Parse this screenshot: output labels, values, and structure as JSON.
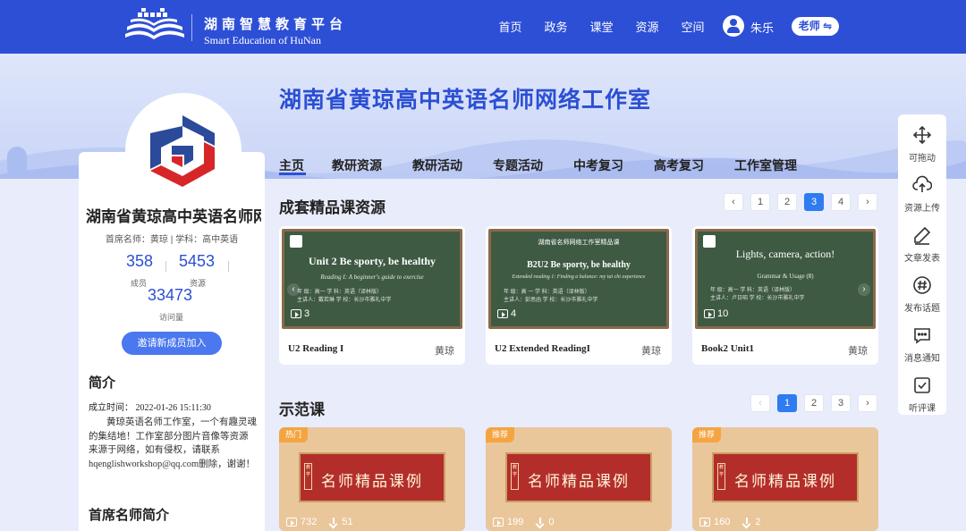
{
  "header": {
    "platform_cn": "湖南智慧教育平台",
    "platform_en": "Smart Education of HuNan",
    "nav": [
      "首页",
      "政务",
      "课堂",
      "资源",
      "空间"
    ],
    "user_name": "朱乐",
    "role": "老师 ⇋"
  },
  "banner": {
    "title": "湖南省黄琼高中英语名师网络工作室"
  },
  "tabs": [
    {
      "label": "主页",
      "active": true
    },
    {
      "label": "教研资源"
    },
    {
      "label": "教研活动"
    },
    {
      "label": "专题活动"
    },
    {
      "label": "中考复习"
    },
    {
      "label": "高考复习"
    },
    {
      "label": "工作室管理"
    }
  ],
  "profile": {
    "name": "湖南省黄琼高中英语名师网络工作室",
    "meta": "首席名师：黄琼  |  学科：高中英语",
    "members_value": "358",
    "members_label": "成员",
    "resources_value": "5453",
    "resources_label": "资源",
    "visits_value": "33473",
    "visits_label": "访问量",
    "invite_label": "邀请新成员加入",
    "intro_heading": "简介",
    "created": "成立时间：   2022-01-26 15:11:30",
    "intro_text": "黄琼英语名师工作室，一个有趣灵魂的集结地！工作室部分图片音像等资源来源于网络，如有侵权，请联系hqenglishworkshop@qq.com删除，谢谢！",
    "chief_heading": "首席名师简介"
  },
  "course_section": {
    "title": "成套精品课资源",
    "pager": {
      "prev": "‹",
      "pages": [
        "1",
        "2",
        "3",
        "4"
      ],
      "active": "3",
      "next": "›"
    },
    "cards": [
      {
        "board_title": "Unit 2 Be sporty, be healthy",
        "board_sub": "Reading I: A beginner's guide to exercise",
        "board_info_1": "年  级：高一          学  科：英语（译林版）",
        "board_info_2": "主讲人：戴若琳        学  校：长沙市雅礼中学",
        "count": "3",
        "title": "U2 Reading I",
        "author": "黄琼"
      },
      {
        "board_head": "湖南省名师网络工作室精品课",
        "board_title": "B2U2 Be sporty, be healthy",
        "board_sub": "Extended reading 1: Finding a balance: my tai chi experience",
        "board_info_1": "年  级：高 一          学  科：英语（译林版）",
        "board_info_2": "主讲人：彭思函        学  校：长沙市雅礼中学",
        "count": "4",
        "title": "U2 Extended ReadingI",
        "author": "黄琼"
      },
      {
        "board_title": "Lights, camera, action!",
        "board_sub": "Grammar & Usage (Ⅱ)",
        "board_info_1": "年  级：高一          学  科：英语（译林版）",
        "board_info_2": "主讲人：卢日昭        学  校：长沙市雅礼中学",
        "count": "10",
        "title": "Book2 Unit1",
        "author": "黄琼"
      }
    ]
  },
  "demo_section": {
    "title": "示范课",
    "pager": {
      "prev": "‹",
      "pages": [
        "1",
        "2",
        "3"
      ],
      "active": "1",
      "next": "›"
    },
    "cards": [
      {
        "badge": "热门",
        "frame_text": "名师精品课例",
        "seal": "教学",
        "views": "732",
        "downloads": "51"
      },
      {
        "badge": "推荐",
        "frame_text": "名师精品课例",
        "seal": "教学",
        "views": "199",
        "downloads": "0"
      },
      {
        "badge": "推荐",
        "frame_text": "名师精品课例",
        "seal": "教学",
        "views": "160",
        "downloads": "2"
      }
    ]
  },
  "toolbar": {
    "drag": "可拖动",
    "upload": "资源上传",
    "article": "文章发表",
    "topic": "发布话题",
    "message": "消息通知",
    "evaluate": "听评课"
  }
}
